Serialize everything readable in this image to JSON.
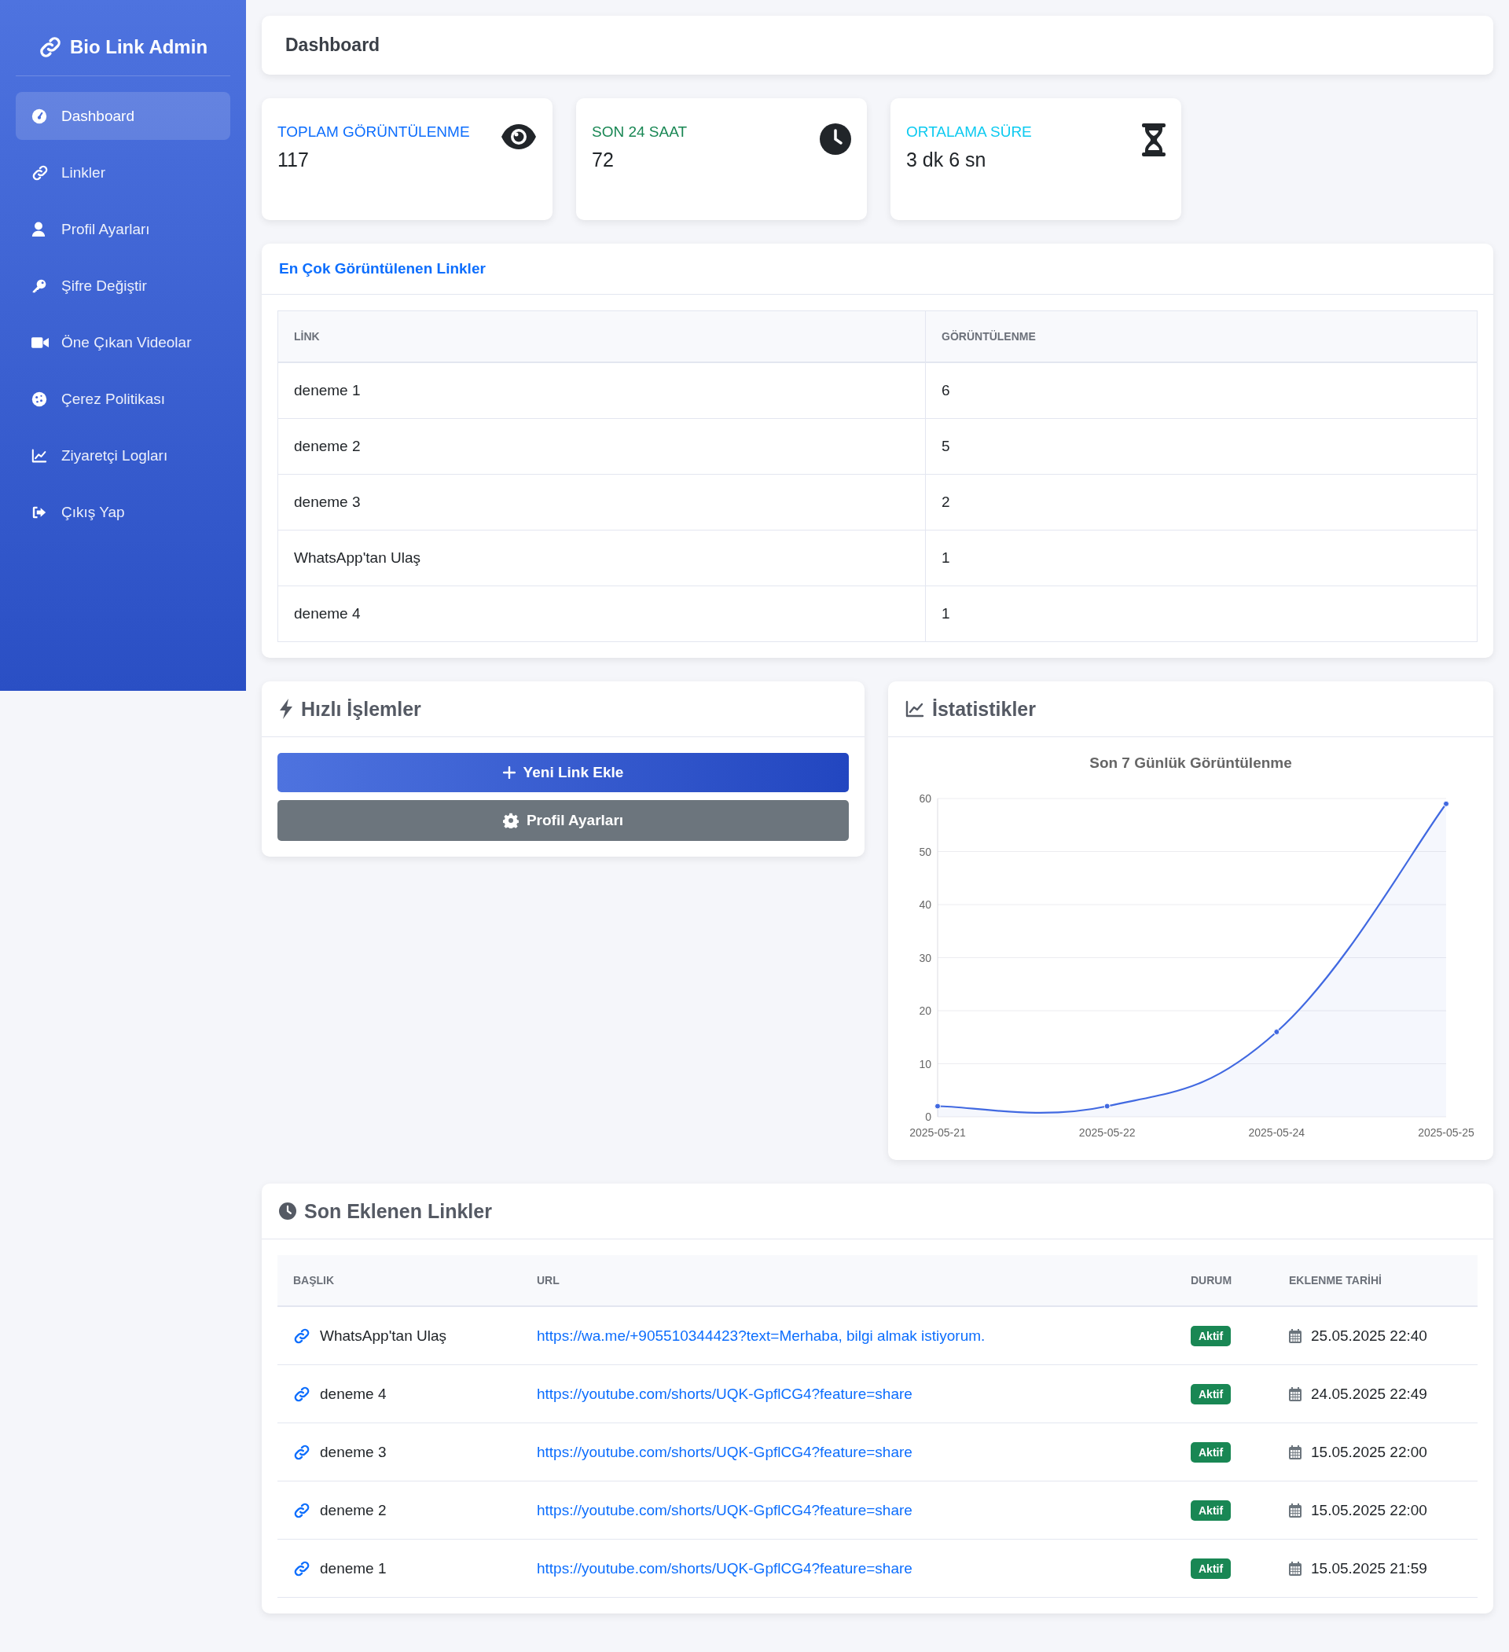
{
  "sidebar": {
    "brand": "Bio Link Admin",
    "items": [
      {
        "label": "Dashboard",
        "selected": true
      },
      {
        "label": "Linkler",
        "selected": false
      },
      {
        "label": "Profil Ayarları",
        "selected": false
      },
      {
        "label": "Şifre Değiştir",
        "selected": false
      },
      {
        "label": "Öne Çıkan Videolar",
        "selected": false
      },
      {
        "label": "Çerez Politikası",
        "selected": false
      },
      {
        "label": "Ziyaretçi Logları",
        "selected": false
      },
      {
        "label": "Çıkış Yap",
        "selected": false
      }
    ]
  },
  "header": {
    "title": "Dashboard"
  },
  "stats": [
    {
      "label": "TOPLAM GÖRÜNTÜLENME",
      "value": "117",
      "color": "#0d6efd"
    },
    {
      "label": "SON 24 SAAT",
      "value": "72",
      "color": "#198754"
    },
    {
      "label": "ORTALAMA SÜRE",
      "value": "3 dk 6 sn",
      "color": "#0dcaf0"
    }
  ],
  "top_links": {
    "title": "En Çok Görüntülenen Linkler",
    "columns": [
      "LİNK",
      "GÖRÜNTÜLENME"
    ],
    "rows": [
      [
        "deneme 1",
        "6"
      ],
      [
        "deneme 2",
        "5"
      ],
      [
        "deneme 3",
        "2"
      ],
      [
        "WhatsApp'tan Ulaş",
        "1"
      ],
      [
        "deneme 4",
        "1"
      ]
    ]
  },
  "quick_actions": {
    "title": "Hızlı İşlemler",
    "buttons": [
      {
        "label": "Yeni Link Ekle",
        "kind": "primary"
      },
      {
        "label": "Profil Ayarları",
        "kind": "secondary"
      }
    ]
  },
  "statistics": {
    "title": "İstatistikler",
    "chart_data": {
      "type": "area",
      "title": "Son 7 Günlük Görüntülenme",
      "categories": [
        "2025-05-21",
        "2025-05-22",
        "2025-05-24",
        "2025-05-25"
      ],
      "series": [
        {
          "color": "#4169e1",
          "values": [
            2,
            2,
            16,
            59
          ]
        }
      ],
      "grid": true,
      "ylim": [
        0,
        60
      ],
      "yticks": [
        0,
        10,
        20,
        30,
        40,
        50,
        60
      ]
    }
  },
  "recent_links": {
    "title": "Son Eklenen Linkler",
    "columns": [
      "BAŞLIK",
      "URL",
      "DURUM",
      "EKLENME TARİHİ"
    ],
    "rows": [
      {
        "title": "WhatsApp'tan Ulaş",
        "url": "https://wa.me/+905510344423?text=Merhaba, bilgi almak istiyorum.",
        "status": "Aktif",
        "date": "25.05.2025 22:40"
      },
      {
        "title": "deneme 4",
        "url": "https://youtube.com/shorts/UQK-GpflCG4?feature=share",
        "status": "Aktif",
        "date": "24.05.2025 22:49"
      },
      {
        "title": "deneme 3",
        "url": "https://youtube.com/shorts/UQK-GpflCG4?feature=share",
        "status": "Aktif",
        "date": "15.05.2025 22:00"
      },
      {
        "title": "deneme 2",
        "url": "https://youtube.com/shorts/UQK-GpflCG4?feature=share",
        "status": "Aktif",
        "date": "15.05.2025 22:00"
      },
      {
        "title": "deneme 1",
        "url": "https://youtube.com/shorts/UQK-GpflCG4?feature=share",
        "status": "Aktif",
        "date": "15.05.2025 21:59"
      }
    ]
  }
}
